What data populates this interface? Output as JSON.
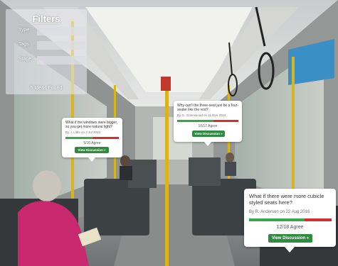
{
  "filters": {
    "title": "Filters",
    "fields": [
      {
        "label": "Type",
        "value": ""
      },
      {
        "label": "Tags",
        "value": ""
      },
      {
        "label": "Stage",
        "value": ""
      }
    ],
    "result_text": "5 Ideas Found"
  },
  "ideas": [
    {
      "question": "What if the windows were bigger, so you get more natural light?",
      "byline": "By J. Little on 3 Jul 2016",
      "agree_text": "5/10 Agree",
      "agree_fraction": 0.5,
      "button_label": "View Discussion »"
    },
    {
      "question": "Why can't the three-seat just be a four-seater like the rest?",
      "byline": "By G. Greenwood on 11 Nov 2016",
      "agree_text": "10/17 Agree",
      "agree_fraction": 0.59,
      "button_label": "View Discussion »"
    },
    {
      "question": "What if there were more cubicle styled seats here?",
      "byline": "By R. Anderson on 22 Aug 2016",
      "agree_text": "12/18 Agree",
      "agree_fraction": 0.67,
      "button_label": "View Discussion »"
    }
  ],
  "colors": {
    "agree_green": "#3aa64b",
    "disagree_red": "#d32f2f",
    "button_green": "#2e8b40"
  }
}
